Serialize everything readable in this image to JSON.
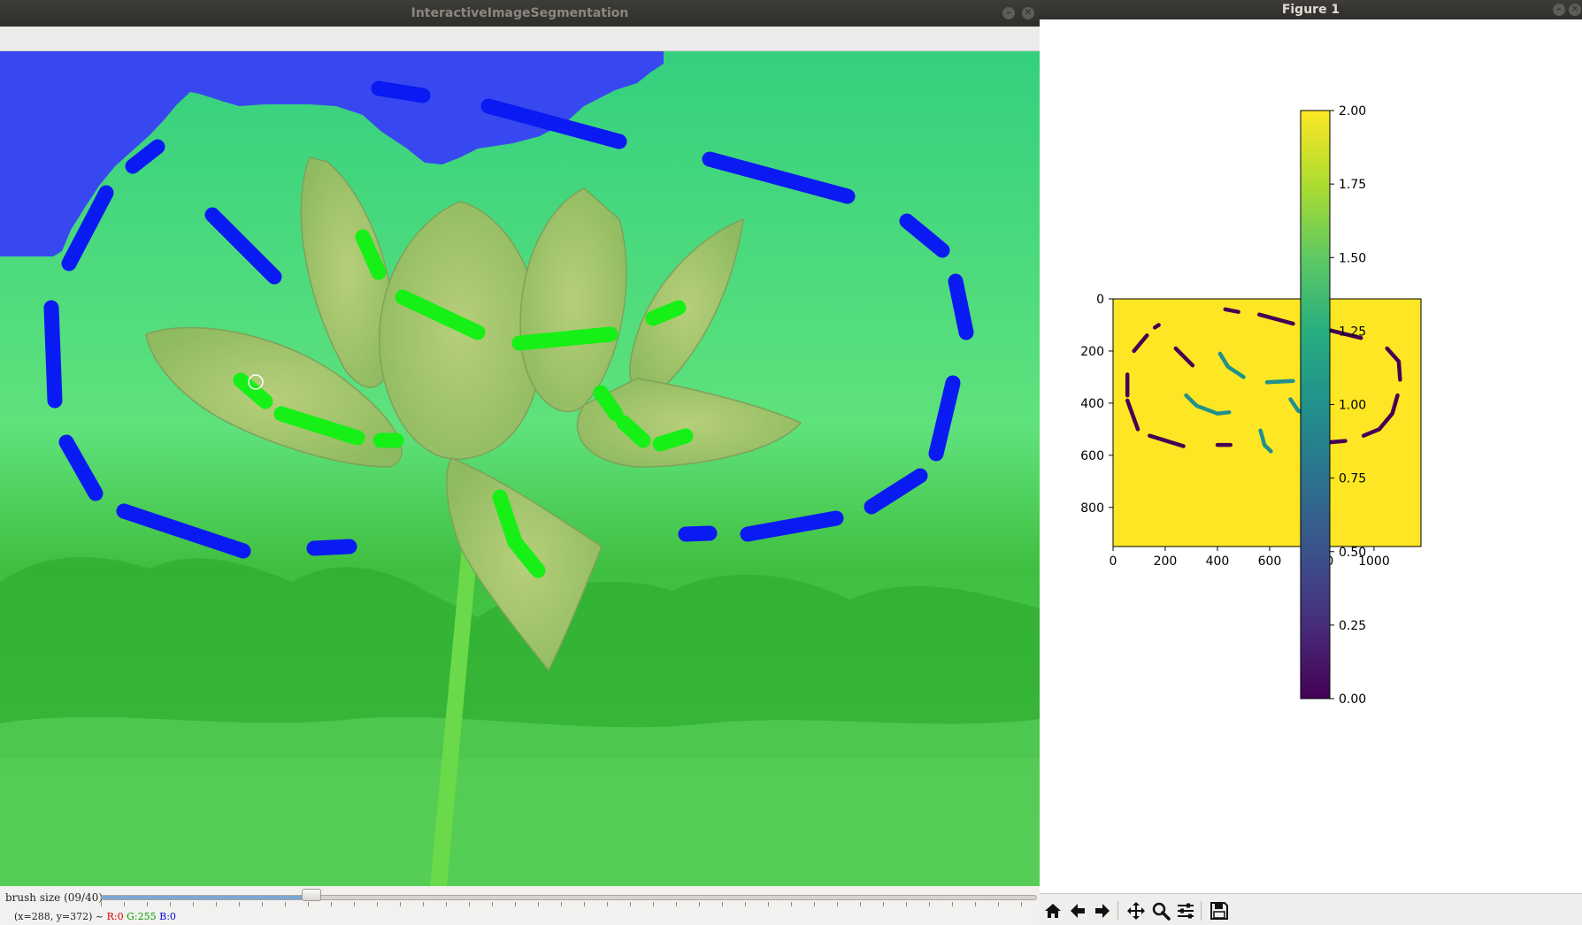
{
  "left_window": {
    "title": "InteractiveImageSegmentation",
    "brush_label": "brush size (09/40)",
    "brush_size": 9,
    "brush_max": 40,
    "status": {
      "coords": "(x=288, y=372) ~",
      "r": "R:0",
      "g": "G:255",
      "b": "B:0"
    }
  },
  "right_window": {
    "title": "Figure 1",
    "toolbar": [
      "home-icon",
      "back-icon",
      "forward-icon",
      "pan-icon",
      "zoom-icon",
      "configure-icon",
      "save-icon"
    ]
  },
  "chart_data": {
    "type": "heatmap",
    "colormap": "viridis",
    "background_value": 2.0,
    "xlim": [
      0,
      1180
    ],
    "ylim": [
      950,
      0
    ],
    "xticks": [
      "0",
      "200",
      "400",
      "600",
      "800",
      "1000"
    ],
    "yticks": [
      "0",
      "200",
      "400",
      "600",
      "800"
    ],
    "colorbar": {
      "range": [
        0,
        2
      ],
      "ticks": [
        "0.00",
        "0.25",
        "0.50",
        "0.75",
        "1.00",
        "1.25",
        "1.50",
        "1.75",
        "2.00"
      ]
    },
    "series": [
      {
        "value": 0,
        "strokes": [
          [
            [
              430,
              40
            ],
            [
              480,
              50
            ]
          ],
          [
            [
              560,
              60
            ],
            [
              690,
              95
            ]
          ],
          [
            [
              810,
              115
            ],
            [
              950,
              150
            ]
          ],
          [
            [
              1050,
              190
            ],
            [
              1095,
              240
            ],
            [
              1100,
              310
            ]
          ],
          [
            [
              1090,
              370
            ],
            [
              1070,
              440
            ],
            [
              1020,
              500
            ],
            [
              960,
              525
            ]
          ],
          [
            [
              890,
              545
            ],
            [
              770,
              555
            ]
          ],
          [
            [
              400,
              560
            ],
            [
              450,
              560
            ]
          ],
          [
            [
              140,
              525
            ],
            [
              270,
              565
            ]
          ],
          [
            [
              55,
              390
            ],
            [
              95,
              500
            ]
          ],
          [
            [
              55,
              290
            ],
            [
              55,
              370
            ]
          ],
          [
            [
              80,
              200
            ],
            [
              130,
              140
            ]
          ],
          [
            [
              160,
              110
            ],
            [
              175,
              100
            ]
          ],
          [
            [
              240,
              190
            ],
            [
              305,
              255
            ]
          ]
        ]
      },
      {
        "value": 1,
        "strokes": [
          [
            [
              410,
              210
            ],
            [
              440,
              260
            ],
            [
              500,
              300
            ]
          ],
          [
            [
              590,
              320
            ],
            [
              690,
              315
            ]
          ],
          [
            [
              760,
              290
            ],
            [
              790,
              270
            ]
          ],
          [
            [
              280,
              370
            ],
            [
              320,
              410
            ],
            [
              400,
              440
            ],
            [
              445,
              435
            ]
          ],
          [
            [
              680,
              385
            ],
            [
              710,
              430
            ],
            [
              760,
              445
            ]
          ],
          [
            [
              565,
              505
            ],
            [
              580,
              560
            ],
            [
              605,
              585
            ]
          ]
        ]
      }
    ]
  }
}
